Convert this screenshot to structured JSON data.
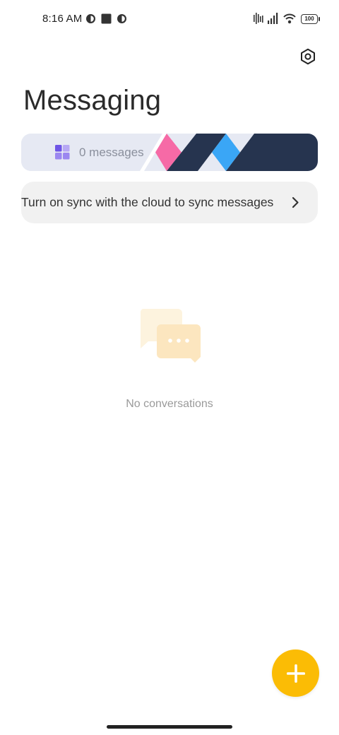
{
  "status_bar": {
    "time": "8:16 AM",
    "battery": "100",
    "icons": [
      "contrast-icon",
      "square-icon",
      "contrast-icon",
      "vibrate-icon",
      "signal-icon",
      "wifi-icon",
      "battery-icon"
    ]
  },
  "header": {
    "title": "Messaging",
    "settings_icon": "hexagon-settings-icon"
  },
  "banner": {
    "count_label": "0 messages",
    "colors": {
      "background": "#e6e9f3",
      "navy": "#26344f",
      "pink": "#f66aa6",
      "blue": "#3aa6f6",
      "grid": "#7b68ee"
    }
  },
  "sync": {
    "text": "Turn on sync with the cloud to sync messages"
  },
  "empty_state": {
    "text": "No conversations"
  },
  "fab": {
    "icon": "plus-icon",
    "color": "#fbbc05"
  }
}
